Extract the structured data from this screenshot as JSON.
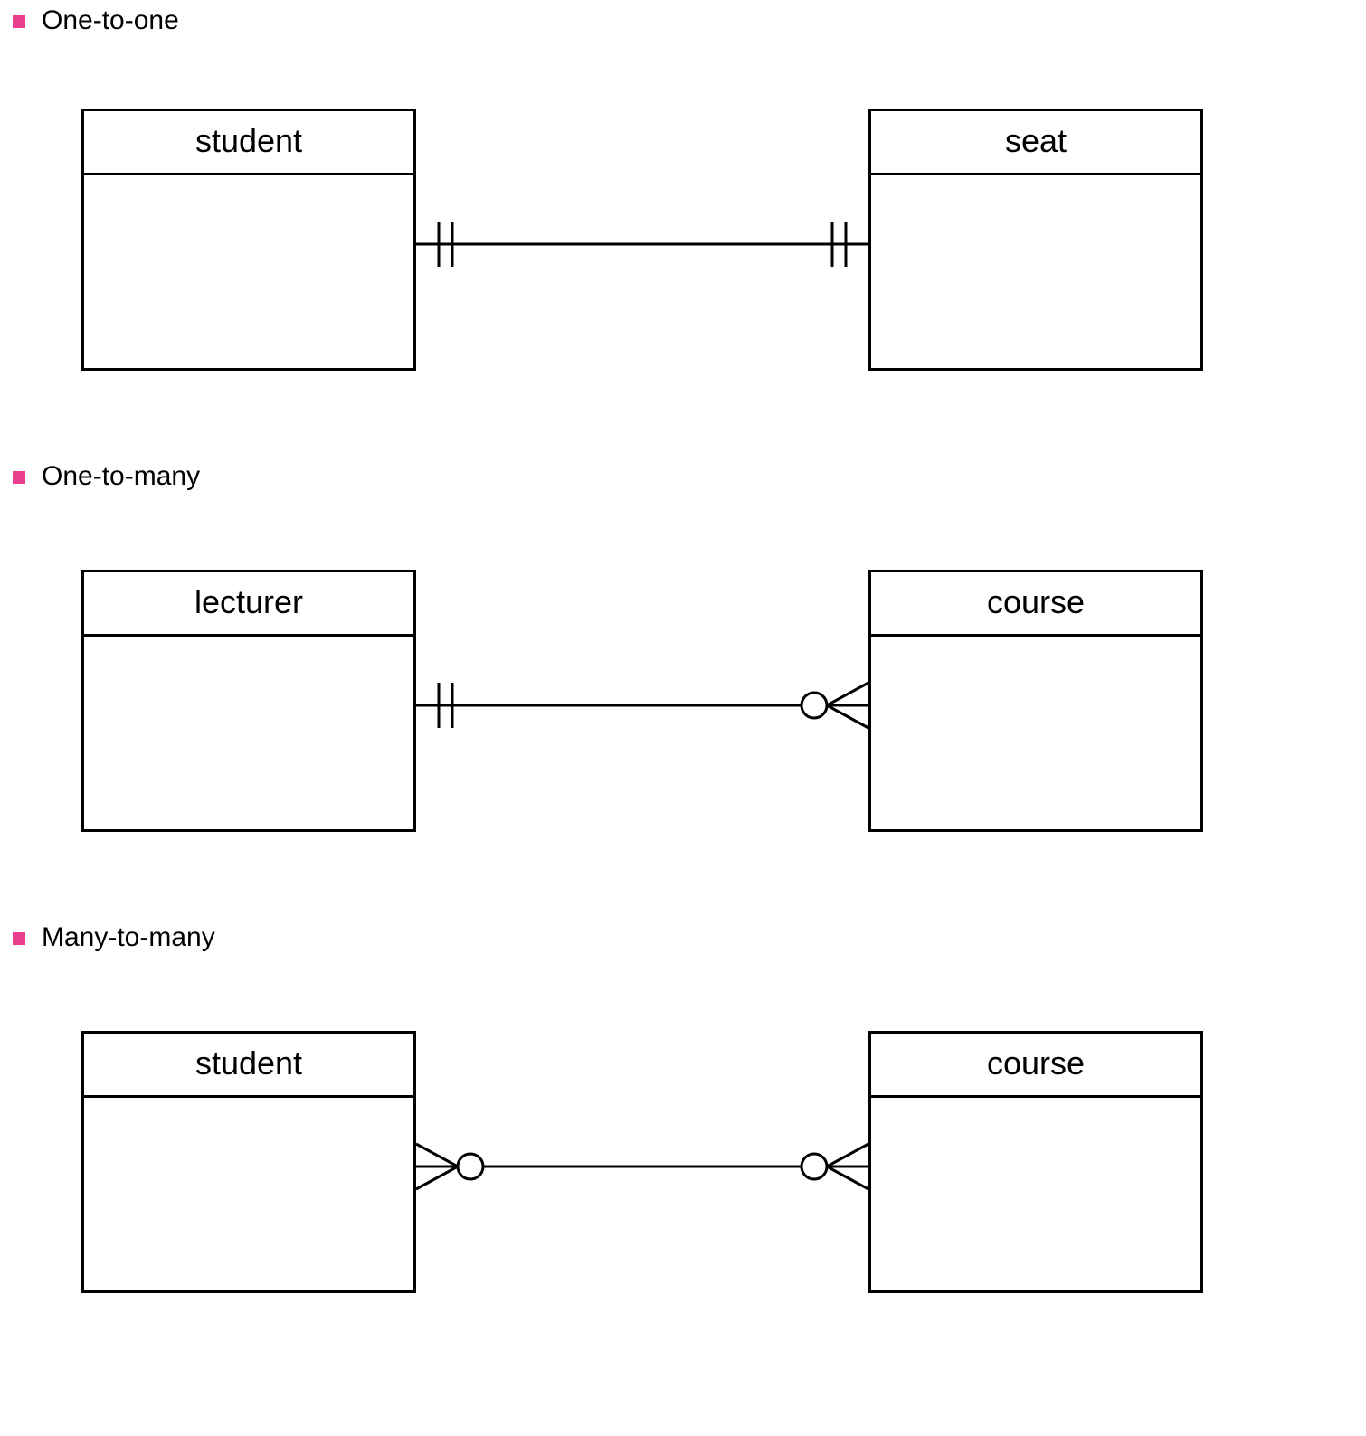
{
  "bullets": {
    "one_to_one": "One-to-one",
    "one_to_many": "One-to-many",
    "many_to_many": "Many-to-many"
  },
  "diagrams": [
    {
      "id": "one-to-one",
      "left_entity": "student",
      "right_entity": "seat",
      "left_cardinality": "one-and-only-one",
      "right_cardinality": "one-and-only-one"
    },
    {
      "id": "one-to-many",
      "left_entity": "lecturer",
      "right_entity": "course",
      "left_cardinality": "one-and-only-one",
      "right_cardinality": "zero-or-many"
    },
    {
      "id": "many-to-many",
      "left_entity": "student",
      "right_entity": "course",
      "left_cardinality": "zero-or-many",
      "right_cardinality": "zero-or-many"
    }
  ],
  "colors": {
    "bullet": "#e83e8c",
    "stroke": "#000000",
    "background": "#ffffff"
  }
}
